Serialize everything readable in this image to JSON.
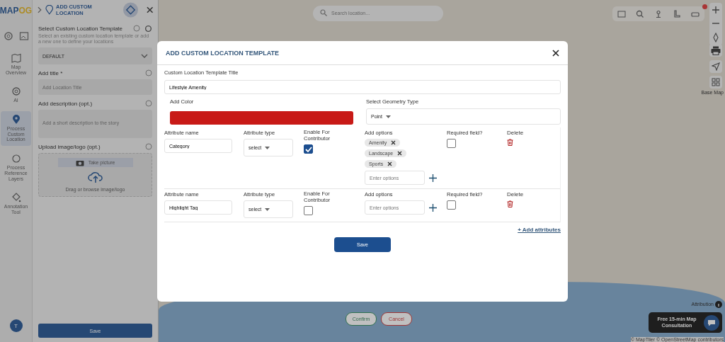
{
  "logo": {
    "text": "MAP",
    "accent": "OG"
  },
  "rail": [
    {
      "label": "Map Overview",
      "selected": false
    },
    {
      "label": "AI",
      "selected": false
    },
    {
      "label": "Process Custom Location",
      "selected": true
    },
    {
      "label": "Process Reference Layers",
      "selected": false
    },
    {
      "label": "Annotation Tool",
      "selected": false
    }
  ],
  "avatar": "T",
  "panel": {
    "title": "ADD CUSTOM LOCATION",
    "template_heading": "Select Custom Location Template",
    "template_hint": "Select an existing custom location template or add a new one to define your locations",
    "template_value": "DEFAULT",
    "title_label": "Add title *",
    "title_placeholder": "Add Location Title",
    "description_label": "Add description (opt.)",
    "description_placeholder": "Add a short description to the story",
    "upload_label": "Upload image/logo (opt.)",
    "take_picture": "Take picture",
    "drag_hint": "Drag or browse image/logo",
    "save": "Save"
  },
  "search": {
    "placeholder": "Search location..."
  },
  "base_map_label": "Base Map",
  "map_buttons": {
    "confirm": "Confirm",
    "cancel": "Cancel"
  },
  "consultation": "Free 15-min Map Consultation",
  "attribution": "Attribution",
  "credits": "© MapTiler © OpenStreetMap contributors",
  "modal": {
    "title": "ADD CUSTOM LOCATION TEMPLATE",
    "template_title_label": "Custom Location Template Title",
    "template_title_value": "Lifestyle Amenity",
    "color_label": "Add Color",
    "color": "#c81a17",
    "geometry_label": "Select Geometry Type",
    "geometry_value": "Point",
    "attributes": [
      {
        "name_label": "Attribute name",
        "name_value": "Category",
        "type_label": "Attribute type",
        "type_value": "select",
        "contributor_label": "Enable For Contributor",
        "contributor_enabled": true,
        "options_label": "Add options",
        "options": [
          "Amenity",
          "Landscape",
          "Sports"
        ],
        "options_placeholder": "Enter options",
        "required_label": "Required field?",
        "required": false,
        "delete_label": "Delete"
      },
      {
        "name_label": "Attribute name",
        "name_value": "Highlight Tag",
        "type_label": "Attribute type",
        "type_value": "select",
        "contributor_label": "Enable For Contributor",
        "contributor_enabled": false,
        "options_label": "Add options",
        "options_placeholder": "Enter options",
        "required_label": "Required field?",
        "required": false,
        "delete_label": "Delete"
      }
    ],
    "add_attributes": "+ Add attributes",
    "save": "Save"
  }
}
